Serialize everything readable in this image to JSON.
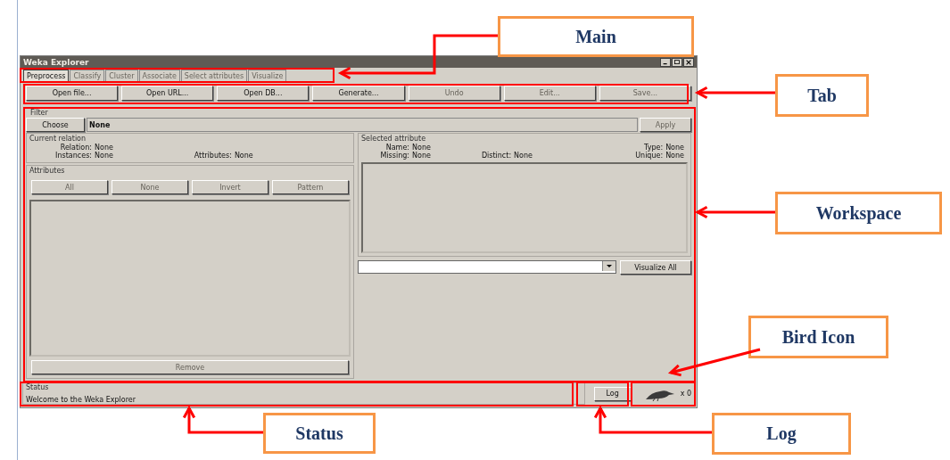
{
  "window": {
    "title": "Weka Explorer"
  },
  "tabs": [
    {
      "label": "Preprocess",
      "selected": true,
      "disabled": false
    },
    {
      "label": "Classify",
      "selected": false,
      "disabled": true
    },
    {
      "label": "Cluster",
      "selected": false,
      "disabled": true
    },
    {
      "label": "Associate",
      "selected": false,
      "disabled": true
    },
    {
      "label": "Select attributes",
      "selected": false,
      "disabled": true
    },
    {
      "label": "Visualize",
      "selected": false,
      "disabled": true
    }
  ],
  "toolbar": [
    {
      "label": "Open file...",
      "disabled": false
    },
    {
      "label": "Open URL...",
      "disabled": false
    },
    {
      "label": "Open DB...",
      "disabled": false
    },
    {
      "label": "Generate...",
      "disabled": false
    },
    {
      "label": "Undo",
      "disabled": true
    },
    {
      "label": "Edit...",
      "disabled": true
    },
    {
      "label": "Save...",
      "disabled": true
    }
  ],
  "filter": {
    "title": "Filter",
    "choose": {
      "label": "Choose",
      "disabled": false
    },
    "value": "None",
    "apply": {
      "label": "Apply",
      "disabled": true
    }
  },
  "current_relation": {
    "title": "Current relation",
    "fields": [
      {
        "label": "Relation:",
        "value": "None"
      },
      {
        "label": "Instances:",
        "value": "None"
      },
      {
        "label": "Attributes:",
        "value": "None"
      }
    ]
  },
  "attributes": {
    "title": "Attributes",
    "buttons": [
      {
        "label": "All",
        "disabled": true
      },
      {
        "label": "None",
        "disabled": true
      },
      {
        "label": "Invert",
        "disabled": true
      },
      {
        "label": "Pattern",
        "disabled": true
      }
    ],
    "remove": {
      "label": "Remove",
      "disabled": true
    }
  },
  "selected_attribute": {
    "title": "Selected attribute",
    "fields": [
      {
        "label": "Name:",
        "value": "None"
      },
      {
        "label": "Type:",
        "value": "None"
      },
      {
        "label": "Missing:",
        "value": "None"
      },
      {
        "label": "Distinct:",
        "value": "None"
      },
      {
        "label": "Unique:",
        "value": "None"
      }
    ],
    "visualize_all": {
      "label": "Visualize All",
      "disabled": false
    }
  },
  "status": {
    "title": "Status",
    "message": "Welcome to the Weka Explorer",
    "log": {
      "label": "Log",
      "disabled": false
    },
    "count": "x 0"
  },
  "annotations": [
    {
      "label": "Main"
    },
    {
      "label": "Tab"
    },
    {
      "label": "Workspace"
    },
    {
      "label": "Bird Icon"
    },
    {
      "label": "Status"
    },
    {
      "label": "Log"
    }
  ]
}
